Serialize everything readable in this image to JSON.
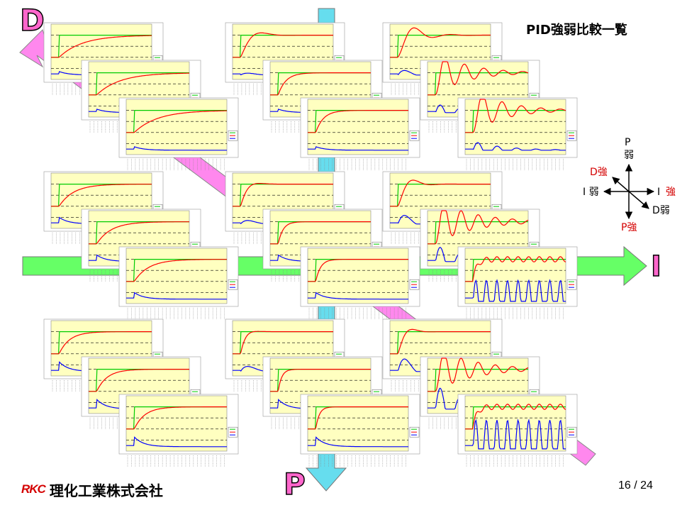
{
  "slide": {
    "title": "PID強弱比較一覧",
    "page": "16 / 24",
    "logo_mark": "RKC",
    "company": "理化工業株式会社"
  },
  "axes": {
    "d_letter": "D",
    "i_letter": "I",
    "p_letter": "P"
  },
  "compass": {
    "p": "P",
    "p_weak": "弱",
    "d_strong": "D強",
    "i_weak": "I 弱",
    "i": "I",
    "i_strong": "強",
    "d_weak": "D弱",
    "p_strong": "P強"
  },
  "colors": {
    "plot_bg": "#ffffc0",
    "sv": "#00cc00",
    "pv": "#ff0000",
    "mv": "#0000ff",
    "accent": "#d40000",
    "arrow_d": "#ff88ee",
    "arrow_i": "#66ff66",
    "arrow_p": "#66ddee"
  },
  "chart_data": {
    "type": "line",
    "layout": "grid of 27 step-response charts (3 P rows × 3 I columns × 3 D layers)",
    "ylim": [
      0,
      250
    ],
    "yticks": [
      0,
      50,
      100,
      150,
      200,
      250
    ],
    "setpoint_before": 100,
    "setpoint_after": 200,
    "series_names": [
      "SV",
      "PV",
      "MV"
    ],
    "charts": [
      {
        "p": "weak",
        "i": "weak",
        "d": "strong",
        "response": "overdamped"
      },
      {
        "p": "weak",
        "i": "weak",
        "d": "medium",
        "response": "overdamped"
      },
      {
        "p": "weak",
        "i": "weak",
        "d": "weak",
        "response": "overdamped"
      },
      {
        "p": "weak",
        "i": "medium",
        "d": "strong",
        "response": "slight overshoot"
      },
      {
        "p": "weak",
        "i": "medium",
        "d": "medium",
        "response": "fast rise"
      },
      {
        "p": "weak",
        "i": "medium",
        "d": "weak",
        "response": "fast rise"
      },
      {
        "p": "weak",
        "i": "strong",
        "d": "strong",
        "response": "overshoot"
      },
      {
        "p": "weak",
        "i": "strong",
        "d": "medium",
        "response": "oscillating"
      },
      {
        "p": "weak",
        "i": "strong",
        "d": "weak",
        "response": "oscillating"
      },
      {
        "p": "medium",
        "i": "weak",
        "d": "strong",
        "response": "overdamped"
      },
      {
        "p": "medium",
        "i": "weak",
        "d": "medium",
        "response": "overdamped"
      },
      {
        "p": "medium",
        "i": "weak",
        "d": "weak",
        "response": "overdamped"
      },
      {
        "p": "medium",
        "i": "medium",
        "d": "strong",
        "response": "slight overshoot"
      },
      {
        "p": "medium",
        "i": "medium",
        "d": "medium",
        "response": "fast rise"
      },
      {
        "p": "medium",
        "i": "medium",
        "d": "weak",
        "response": "fast rise"
      },
      {
        "p": "medium",
        "i": "strong",
        "d": "strong",
        "response": "overshoot"
      },
      {
        "p": "medium",
        "i": "strong",
        "d": "medium",
        "response": "damped oscillation"
      },
      {
        "p": "medium",
        "i": "strong",
        "d": "weak",
        "response": "sustained oscillation"
      },
      {
        "p": "strong",
        "i": "weak",
        "d": "strong",
        "response": "overdamped"
      },
      {
        "p": "strong",
        "i": "weak",
        "d": "medium",
        "response": "overdamped"
      },
      {
        "p": "strong",
        "i": "weak",
        "d": "weak",
        "response": "overdamped"
      },
      {
        "p": "strong",
        "i": "medium",
        "d": "strong",
        "response": "slight overshoot"
      },
      {
        "p": "strong",
        "i": "medium",
        "d": "medium",
        "response": "fast rise"
      },
      {
        "p": "strong",
        "i": "medium",
        "d": "weak",
        "response": "fast rise"
      },
      {
        "p": "strong",
        "i": "strong",
        "d": "strong",
        "response": "overshoot"
      },
      {
        "p": "strong",
        "i": "strong",
        "d": "medium",
        "response": "damped oscillation"
      },
      {
        "p": "strong",
        "i": "strong",
        "d": "weak",
        "response": "sustained oscillation"
      }
    ]
  }
}
